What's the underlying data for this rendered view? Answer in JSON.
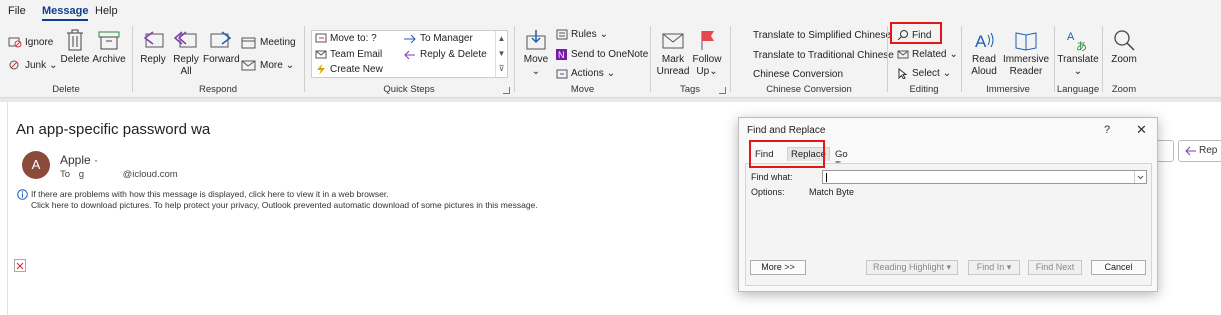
{
  "menu": {
    "file": "File",
    "message": "Message",
    "help": "Help"
  },
  "ribbon": {
    "delete_group": {
      "ignore": "Ignore",
      "junk": "Junk",
      "delete": "Delete",
      "archive": "Archive",
      "label": "Delete"
    },
    "respond_group": {
      "reply": "Reply",
      "reply_all_1": "Reply",
      "reply_all_2": "All",
      "forward": "Forward",
      "meeting": "Meeting",
      "more": "More",
      "label": "Respond"
    },
    "quicksteps": {
      "move_to": "Move to: ?",
      "team_email": "Team Email",
      "create_new": "Create New",
      "to_manager": "To Manager",
      "reply_delete": "Reply & Delete",
      "label": "Quick Steps"
    },
    "move_group": {
      "move": "Move",
      "rules": "Rules",
      "onenote": "Send to OneNote",
      "actions": "Actions",
      "label": "Move"
    },
    "tags_group": {
      "mark_1": "Mark",
      "mark_2": "Unread",
      "follow_1": "Follow",
      "follow_2": "Up",
      "label": "Tags"
    },
    "chinese_group": {
      "simplified": "Translate to Simplified Chinese",
      "traditional": "Translate to Traditional Chinese",
      "conversion": "Chinese Conversion",
      "label": "Chinese Conversion"
    },
    "editing_group": {
      "find": "Find",
      "related": "Related",
      "select": "Select",
      "label": "Editing"
    },
    "immersive_group": {
      "read_1": "Read",
      "read_2": "Aloud",
      "reader_1": "Immersive",
      "reader_2": "Reader",
      "label": "Immersive"
    },
    "language_group": {
      "translate": "Translate",
      "label": "Language"
    },
    "zoom_group": {
      "zoom": "Zoom",
      "label": "Zoom"
    }
  },
  "message": {
    "subject": "An app-specific password wa",
    "avatar_letter": "A",
    "sender": "Apple ·",
    "to_prefix": "To",
    "to_initial": "g",
    "to_domain": "@icloud.com",
    "info_line1": "If there are problems with how this message is displayed, click here to view it in a web browser.",
    "info_line2": "Click here to download pictures. To help protect your privacy, Outlook prevented automatic download of some pictures in this message.",
    "right_button": "Rep"
  },
  "dialog": {
    "title": "Find and Replace",
    "help": "?",
    "close": "✕",
    "tabs": [
      "Find",
      "Replace",
      "Go To"
    ],
    "find_what_label": "Find what:",
    "options_label": "Options:",
    "options_value": "Match Byte",
    "buttons": {
      "more": "More >>",
      "reading_highlight": "Reading Highlight ▾",
      "find_in": "Find In ▾",
      "find_next": "Find Next",
      "cancel": "Cancel"
    }
  }
}
